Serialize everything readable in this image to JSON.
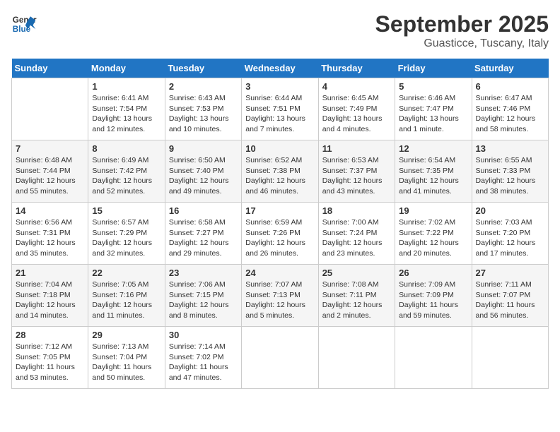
{
  "logo": {
    "line1": "General",
    "line2": "Blue"
  },
  "title": "September 2025",
  "subtitle": "Guasticce, Tuscany, Italy",
  "weekdays": [
    "Sunday",
    "Monday",
    "Tuesday",
    "Wednesday",
    "Thursday",
    "Friday",
    "Saturday"
  ],
  "weeks": [
    [
      {
        "day": "",
        "info": ""
      },
      {
        "day": "1",
        "info": "Sunrise: 6:41 AM\nSunset: 7:54 PM\nDaylight: 13 hours\nand 12 minutes."
      },
      {
        "day": "2",
        "info": "Sunrise: 6:43 AM\nSunset: 7:53 PM\nDaylight: 13 hours\nand 10 minutes."
      },
      {
        "day": "3",
        "info": "Sunrise: 6:44 AM\nSunset: 7:51 PM\nDaylight: 13 hours\nand 7 minutes."
      },
      {
        "day": "4",
        "info": "Sunrise: 6:45 AM\nSunset: 7:49 PM\nDaylight: 13 hours\nand 4 minutes."
      },
      {
        "day": "5",
        "info": "Sunrise: 6:46 AM\nSunset: 7:47 PM\nDaylight: 13 hours\nand 1 minute."
      },
      {
        "day": "6",
        "info": "Sunrise: 6:47 AM\nSunset: 7:46 PM\nDaylight: 12 hours\nand 58 minutes."
      }
    ],
    [
      {
        "day": "7",
        "info": "Sunrise: 6:48 AM\nSunset: 7:44 PM\nDaylight: 12 hours\nand 55 minutes."
      },
      {
        "day": "8",
        "info": "Sunrise: 6:49 AM\nSunset: 7:42 PM\nDaylight: 12 hours\nand 52 minutes."
      },
      {
        "day": "9",
        "info": "Sunrise: 6:50 AM\nSunset: 7:40 PM\nDaylight: 12 hours\nand 49 minutes."
      },
      {
        "day": "10",
        "info": "Sunrise: 6:52 AM\nSunset: 7:38 PM\nDaylight: 12 hours\nand 46 minutes."
      },
      {
        "day": "11",
        "info": "Sunrise: 6:53 AM\nSunset: 7:37 PM\nDaylight: 12 hours\nand 43 minutes."
      },
      {
        "day": "12",
        "info": "Sunrise: 6:54 AM\nSunset: 7:35 PM\nDaylight: 12 hours\nand 41 minutes."
      },
      {
        "day": "13",
        "info": "Sunrise: 6:55 AM\nSunset: 7:33 PM\nDaylight: 12 hours\nand 38 minutes."
      }
    ],
    [
      {
        "day": "14",
        "info": "Sunrise: 6:56 AM\nSunset: 7:31 PM\nDaylight: 12 hours\nand 35 minutes."
      },
      {
        "day": "15",
        "info": "Sunrise: 6:57 AM\nSunset: 7:29 PM\nDaylight: 12 hours\nand 32 minutes."
      },
      {
        "day": "16",
        "info": "Sunrise: 6:58 AM\nSunset: 7:27 PM\nDaylight: 12 hours\nand 29 minutes."
      },
      {
        "day": "17",
        "info": "Sunrise: 6:59 AM\nSunset: 7:26 PM\nDaylight: 12 hours\nand 26 minutes."
      },
      {
        "day": "18",
        "info": "Sunrise: 7:00 AM\nSunset: 7:24 PM\nDaylight: 12 hours\nand 23 minutes."
      },
      {
        "day": "19",
        "info": "Sunrise: 7:02 AM\nSunset: 7:22 PM\nDaylight: 12 hours\nand 20 minutes."
      },
      {
        "day": "20",
        "info": "Sunrise: 7:03 AM\nSunset: 7:20 PM\nDaylight: 12 hours\nand 17 minutes."
      }
    ],
    [
      {
        "day": "21",
        "info": "Sunrise: 7:04 AM\nSunset: 7:18 PM\nDaylight: 12 hours\nand 14 minutes."
      },
      {
        "day": "22",
        "info": "Sunrise: 7:05 AM\nSunset: 7:16 PM\nDaylight: 12 hours\nand 11 minutes."
      },
      {
        "day": "23",
        "info": "Sunrise: 7:06 AM\nSunset: 7:15 PM\nDaylight: 12 hours\nand 8 minutes."
      },
      {
        "day": "24",
        "info": "Sunrise: 7:07 AM\nSunset: 7:13 PM\nDaylight: 12 hours\nand 5 minutes."
      },
      {
        "day": "25",
        "info": "Sunrise: 7:08 AM\nSunset: 7:11 PM\nDaylight: 12 hours\nand 2 minutes."
      },
      {
        "day": "26",
        "info": "Sunrise: 7:09 AM\nSunset: 7:09 PM\nDaylight: 11 hours\nand 59 minutes."
      },
      {
        "day": "27",
        "info": "Sunrise: 7:11 AM\nSunset: 7:07 PM\nDaylight: 11 hours\nand 56 minutes."
      }
    ],
    [
      {
        "day": "28",
        "info": "Sunrise: 7:12 AM\nSunset: 7:05 PM\nDaylight: 11 hours\nand 53 minutes."
      },
      {
        "day": "29",
        "info": "Sunrise: 7:13 AM\nSunset: 7:04 PM\nDaylight: 11 hours\nand 50 minutes."
      },
      {
        "day": "30",
        "info": "Sunrise: 7:14 AM\nSunset: 7:02 PM\nDaylight: 11 hours\nand 47 minutes."
      },
      {
        "day": "",
        "info": ""
      },
      {
        "day": "",
        "info": ""
      },
      {
        "day": "",
        "info": ""
      },
      {
        "day": "",
        "info": ""
      }
    ]
  ]
}
